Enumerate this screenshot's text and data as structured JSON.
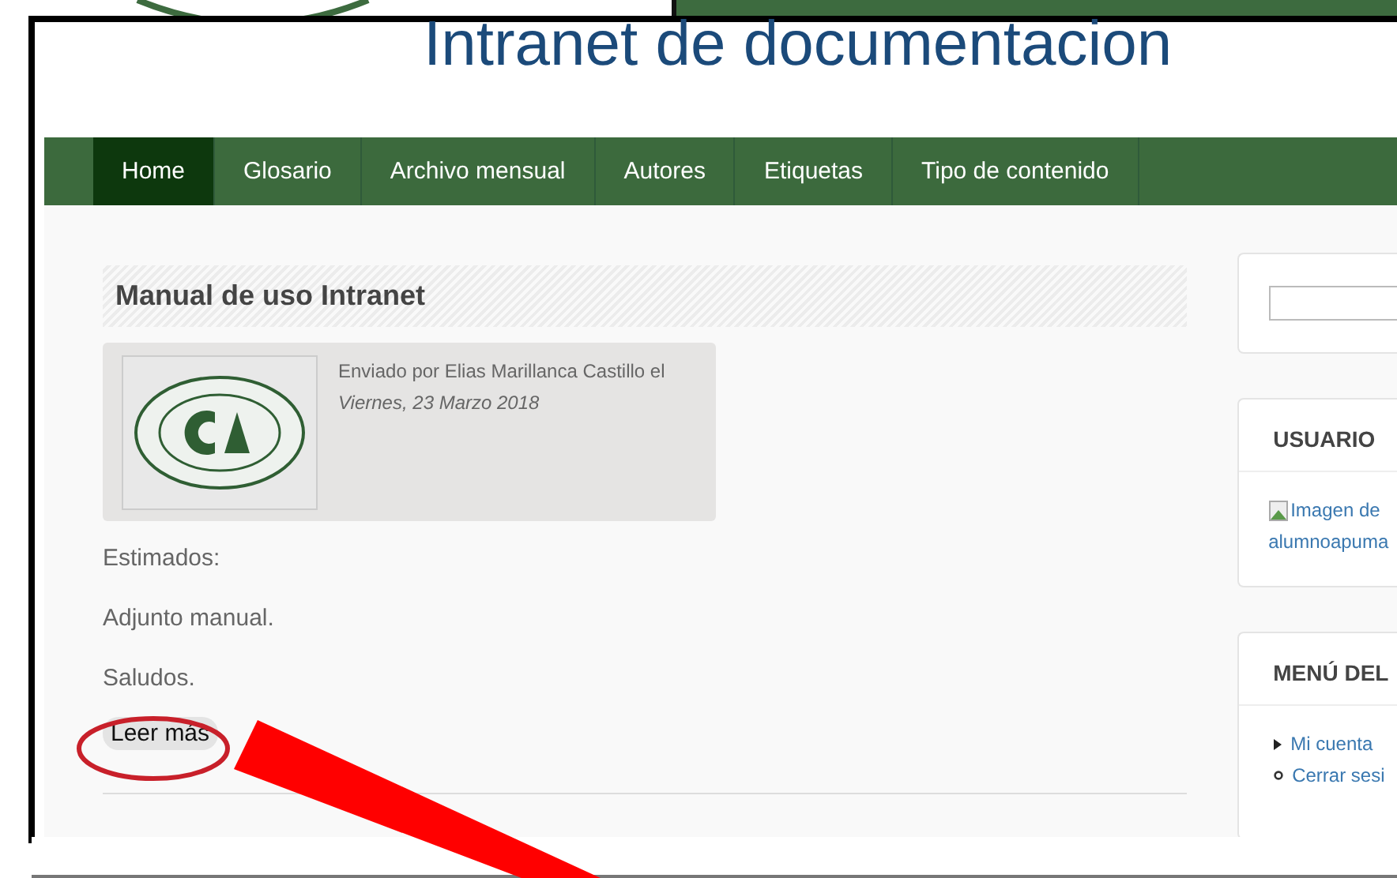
{
  "header": {
    "title": "Intranet de documentacion"
  },
  "nav": [
    {
      "label": "Home",
      "selected": true
    },
    {
      "label": "Glosario",
      "selected": false
    },
    {
      "label": "Archivo mensual",
      "selected": false
    },
    {
      "label": "Autores",
      "selected": false
    },
    {
      "label": "Etiquetas",
      "selected": false
    },
    {
      "label": "Tipo de contenido",
      "selected": false
    }
  ],
  "article": {
    "title": "Manual de uso Intranet",
    "submitted": "Enviado por Elias Marillanca Castillo el",
    "date": "Viernes, 23 Marzo 2018",
    "paragraphs": [
      "Estimados:",
      "Adjunto manual.",
      "Saludos."
    ],
    "read_more": "Leer más"
  },
  "sidebar": {
    "user": {
      "heading": "USUARIO",
      "image_alt": "Imagen de",
      "username": "alumnoapuma"
    },
    "menu": {
      "heading": "MENÚ DEL",
      "items": [
        {
          "label": "Mi cuenta",
          "kind": "arrow"
        },
        {
          "label": "Cerrar sesi",
          "kind": "circle"
        }
      ]
    }
  }
}
